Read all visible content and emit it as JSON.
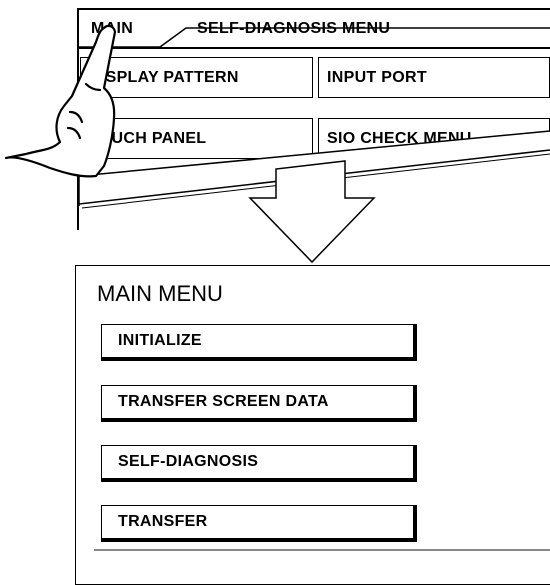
{
  "top_screen": {
    "main_tab": "MAIN",
    "title": "SELF-DIAGNOSIS MENU",
    "buttons": [
      {
        "label": "DISPLAY PATTERN"
      },
      {
        "label": "INPUT PORT"
      },
      {
        "label": "TOUCH PANEL"
      },
      {
        "label": "SIO CHECK MENU"
      }
    ]
  },
  "main_menu": {
    "title": "MAIN MENU",
    "items": [
      {
        "label": "INITIALIZE"
      },
      {
        "label": "TRANSFER SCREEN DATA"
      },
      {
        "label": "SELF-DIAGNOSIS"
      },
      {
        "label": "TRANSFER"
      }
    ]
  }
}
